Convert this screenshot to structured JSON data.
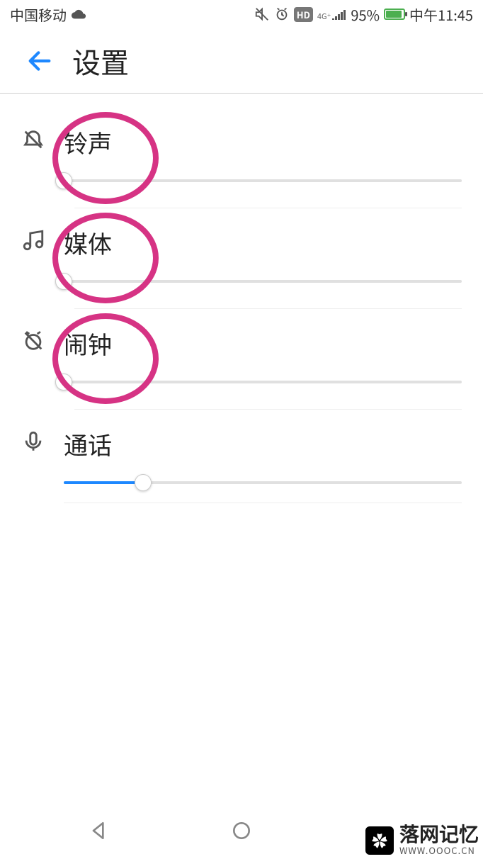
{
  "status": {
    "carrier": "中国移动",
    "battery_pct": "95%",
    "time": "中午11:45",
    "hd": "HD",
    "net": "4G⁺"
  },
  "header": {
    "title": "设置"
  },
  "sliders": {
    "ringtone": {
      "label": "铃声",
      "value": 0
    },
    "media": {
      "label": "媒体",
      "value": 0
    },
    "alarm": {
      "label": "闹钟",
      "value": 0
    },
    "call": {
      "label": "通话",
      "value": 20
    }
  },
  "watermark": {
    "main": "落网记忆",
    "sub": "WWW.OOOC.CN"
  }
}
